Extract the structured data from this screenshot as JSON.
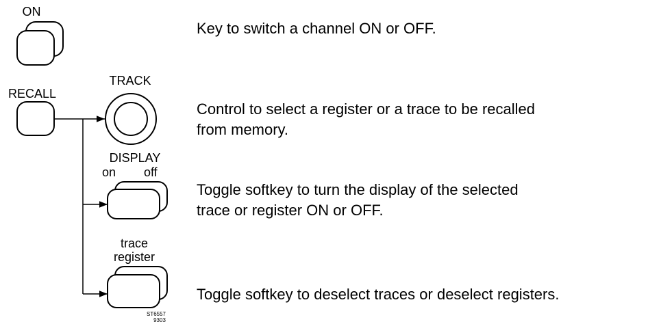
{
  "diagram": {
    "on_key_label": "ON",
    "recall_key_label": "RECALL",
    "track_control_label": "TRACK",
    "display_softkey_label": "DISPLAY",
    "display_softkey_on": "on",
    "display_softkey_off": "off",
    "trace_softkey_label_top": "trace",
    "trace_softkey_label_bottom": "register",
    "figure_code": "ST6557",
    "figure_code_sub": "9303"
  },
  "descriptions": {
    "on_key": [
      "Key to switch a channel ON or OFF."
    ],
    "track": [
      "Control to select a register or a trace to be recalled",
      "from memory."
    ],
    "display": [
      "Toggle softkey to turn the display of the selected",
      "trace or register ON or OFF."
    ],
    "trace_register": [
      "Toggle softkey to deselect traces or deselect registers."
    ]
  }
}
